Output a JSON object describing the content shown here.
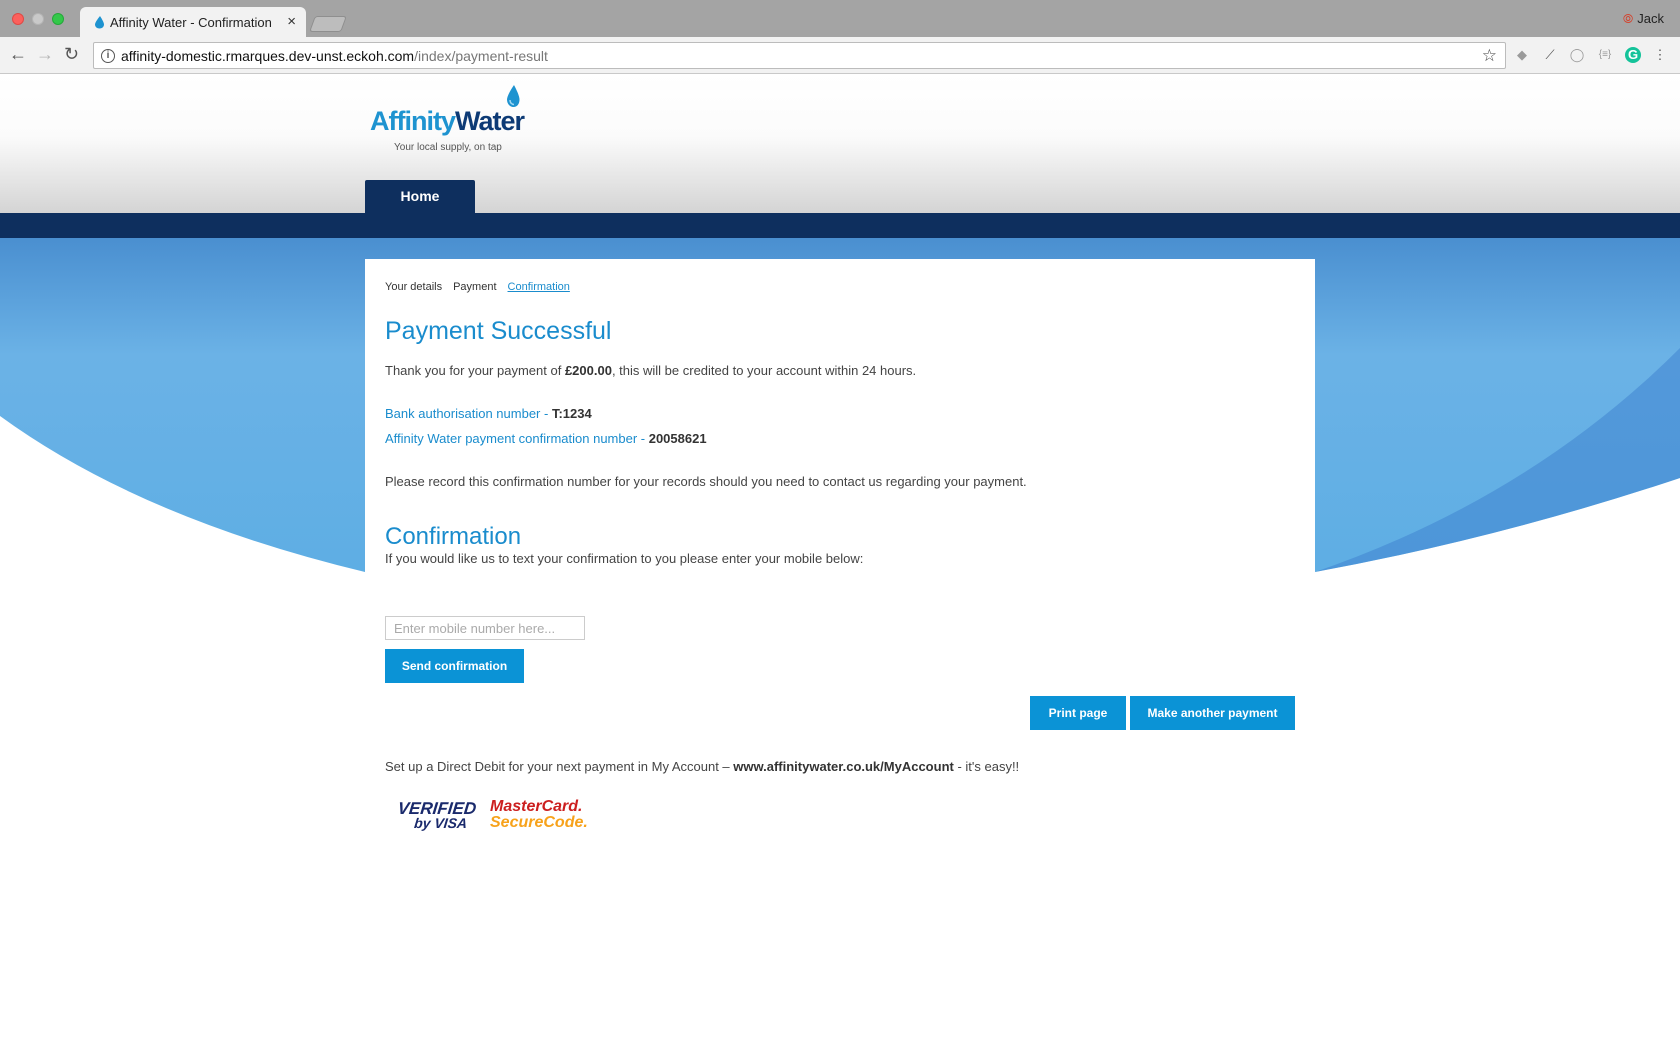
{
  "browser": {
    "tab_title": "Affinity Water - Confirmation",
    "tab_close": "×",
    "profile_name": "Jack",
    "url_host": "affinity-domestic.rmarques.dev-unst.eckoh.com",
    "url_path": "/index/payment-result",
    "back_glyph": "←",
    "forward_glyph": "→",
    "reload_glyph": "↻",
    "star_glyph": "☆",
    "info_glyph": "i"
  },
  "brand": {
    "name_part1": "Affinity",
    "name_part2": "Water",
    "tagline": "Your local supply, on tap",
    "primary_color": "#1a8ccd",
    "navy_color": "#0e2f5e"
  },
  "nav": {
    "home_label": "Home"
  },
  "steps": [
    "Your details",
    "Payment",
    "Confirmation"
  ],
  "payment": {
    "heading": "Payment Successful",
    "thanks_prefix": "Thank you for your payment of ",
    "amount": "£200.00",
    "thanks_suffix": ", this will be credited to your account within 24 hours.",
    "bank_auth_label": "Bank authorisation number - ",
    "bank_auth_value": "T:1234",
    "confirm_label": "Affinity Water payment confirmation number - ",
    "confirm_value": "20058621",
    "record_note": "Please record this confirmation number for your records should you need to contact us regarding your payment."
  },
  "confirmation": {
    "heading": "Confirmation",
    "prompt": "If you would like us to text your confirmation to you please enter your mobile below:",
    "mobile_placeholder": "Enter mobile number here...",
    "send_label": "Send confirmation"
  },
  "actions": {
    "print_label": "Print page",
    "another_label": "Make another payment"
  },
  "direct_debit": {
    "prefix": "Set up a Direct Debit for your next payment in My Account – ",
    "link": "www.affinitywater.co.uk/MyAccount",
    "suffix": " - it's easy!!"
  },
  "badges": {
    "visa_line1": "VERIFIED",
    "visa_line2": "by VISA",
    "mc_line1": "MasterCard.",
    "mc_line2": "SecureCode."
  }
}
